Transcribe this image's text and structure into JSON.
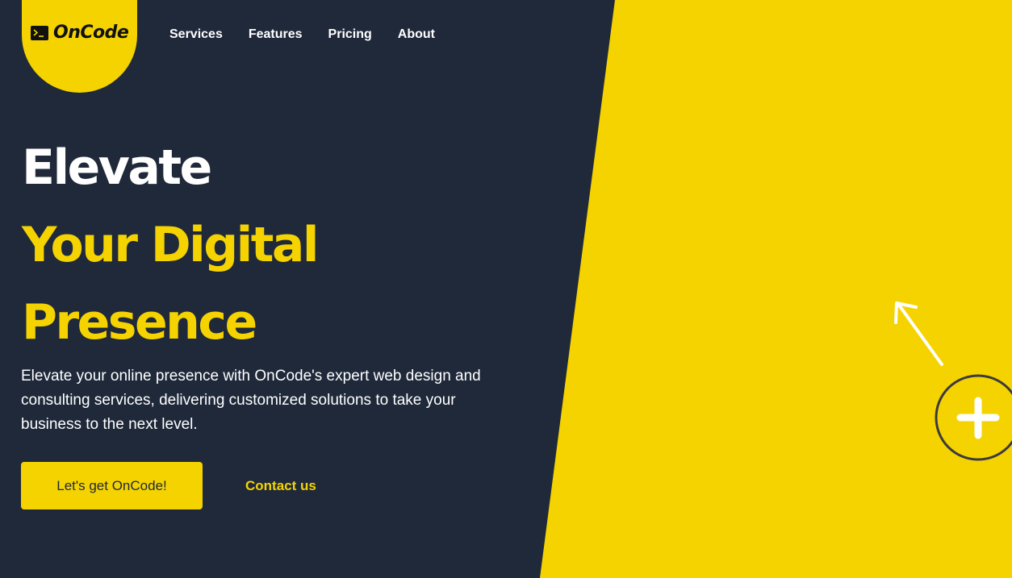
{
  "brand": {
    "name": "OnCode",
    "logo_icon": "terminal-icon"
  },
  "nav": {
    "items": [
      {
        "label": "Services"
      },
      {
        "label": "Features"
      },
      {
        "label": "Pricing"
      },
      {
        "label": "About"
      }
    ]
  },
  "hero": {
    "title_line1": "Elevate",
    "title_line2": "Your Digital",
    "title_line3": "Presence",
    "description": "Elevate your online presence with OnCode's expert web design and consulting services, delivering customized solutions to take your business to the next level.",
    "cta_label": "Let's get OnCode!",
    "contact_label": "Contact us"
  },
  "illustration": {
    "icons": [
      "plus-icon",
      "arrow-icon"
    ]
  },
  "colors": {
    "background": "#1f293a",
    "accent": "#f5d300",
    "text": "#ffffff"
  }
}
